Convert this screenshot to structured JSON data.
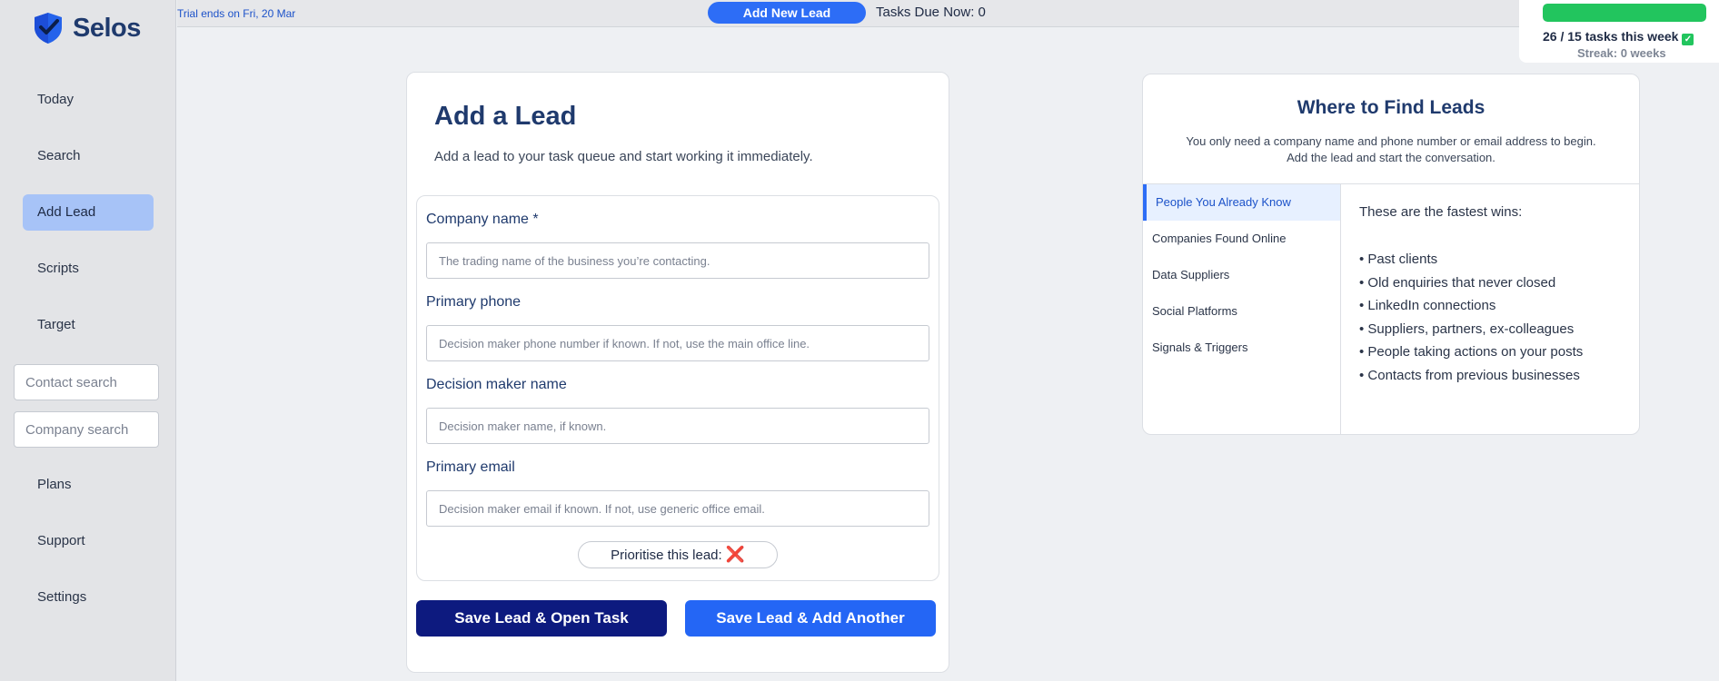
{
  "app": {
    "name": "Selos"
  },
  "topbar": {
    "trial": "Trial ends on Fri, 20 Mar",
    "add_new_lead": "Add New Lead",
    "tasks_due": "Tasks Due Now: 0"
  },
  "progress": {
    "done": 26,
    "target": 15,
    "label": "26 / 15  tasks this week",
    "fill_fraction": 1.0,
    "streak": "Streak: 0 weeks",
    "fill_color": "#22c55e"
  },
  "sidebar": {
    "items_top": [
      {
        "label": "Today"
      },
      {
        "label": "Search"
      },
      {
        "label": "Add Lead",
        "active": true
      },
      {
        "label": "Scripts"
      },
      {
        "label": "Target"
      }
    ],
    "contact_search_placeholder": "Contact search",
    "company_search_placeholder": "Company search",
    "items_bottom": [
      {
        "label": "Plans"
      },
      {
        "label": "Support"
      },
      {
        "label": "Settings"
      }
    ]
  },
  "form": {
    "title": "Add a Lead",
    "description": "Add a lead to your task queue and start working it immediately.",
    "fields": [
      {
        "label": "Company name *",
        "placeholder": "The trading name of the business you’re contacting."
      },
      {
        "label": "Primary phone",
        "placeholder": "Decision maker phone number if known. If not, use the main office line."
      },
      {
        "label": "Decision maker name",
        "placeholder": "Decision maker name, if known."
      },
      {
        "label": "Primary email",
        "placeholder": "Decision maker email if known. If not, use generic office email."
      }
    ],
    "prioritise_label": "Prioritise this lead:",
    "prioritise_value": "❌",
    "save_open_task": "Save Lead & Open Task",
    "save_add_another": "Save Lead & Add Another"
  },
  "info": {
    "title": "Where to Find Leads",
    "subtitle_line1": "You only need a company name and phone number or email address to begin.",
    "subtitle_line2": "Add the lead and start the conversation.",
    "tabs": [
      {
        "label": "People You Already Know",
        "active": true
      },
      {
        "label": "Companies Found Online"
      },
      {
        "label": "Data Suppliers"
      },
      {
        "label": "Social Platforms"
      },
      {
        "label": "Signals & Triggers"
      }
    ],
    "content_heading": "These are the fastest wins:",
    "content_items": [
      "• Past clients",
      "• Old enquiries that never closed",
      "• LinkedIn connections",
      "• Suppliers, partners, ex-colleagues",
      "• People taking actions on your posts",
      "• Contacts from previous businesses"
    ]
  },
  "colors": {
    "accent": "#2d6df6",
    "dark_button": "#0d1a7f",
    "active_nav": "#a7c3f7"
  }
}
